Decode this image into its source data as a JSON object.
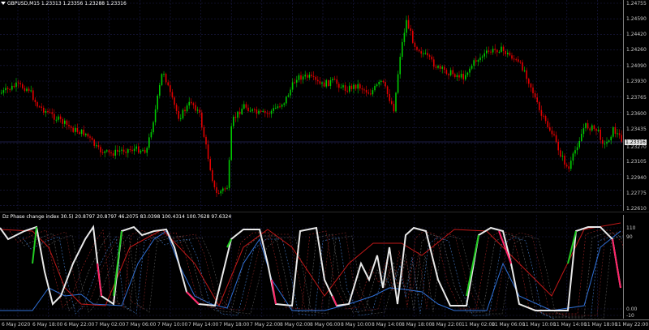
{
  "chart": {
    "symbol_title": "GBPUSD,M15  1.23313 1.23356 1.23288 1.23316",
    "price_ticks": [
      "1.24755",
      "1.24590",
      "1.24420",
      "1.24260",
      "1.24090",
      "1.23930",
      "1.23765",
      "1.23600",
      "1.23435",
      "1.23270",
      "1.23105",
      "1.22940",
      "1.22775",
      "1.22610"
    ],
    "current_price": "1.23316",
    "bull_color": "#00c800",
    "bear_color": "#e00000"
  },
  "indicator": {
    "title": "Dz Phase change index 30.5) 20.8797 20.8797 46.2075 83.0398 100.4314 100.7628 97.6324",
    "level_ticks": [
      "110",
      "90",
      "0.00",
      "-10"
    ]
  },
  "time_axis": {
    "labels": [
      "6 May 2020",
      "6 May 18:00",
      "6 May 22:00",
      "7 May 02:00",
      "7 May 06:00",
      "7 May 10:00",
      "7 May 14:00",
      "7 May 18:00",
      "7 May 22:00",
      "8 May 02:00",
      "8 May 06:00",
      "8 May 10:00",
      "8 May 14:00",
      "8 May 18:00",
      "8 May 22:00",
      "11 May 02:00",
      "11 May 06:00",
      "11 May 10:00",
      "11 May 14:00",
      "11 May 18:00",
      "11 May 22:00"
    ]
  }
}
